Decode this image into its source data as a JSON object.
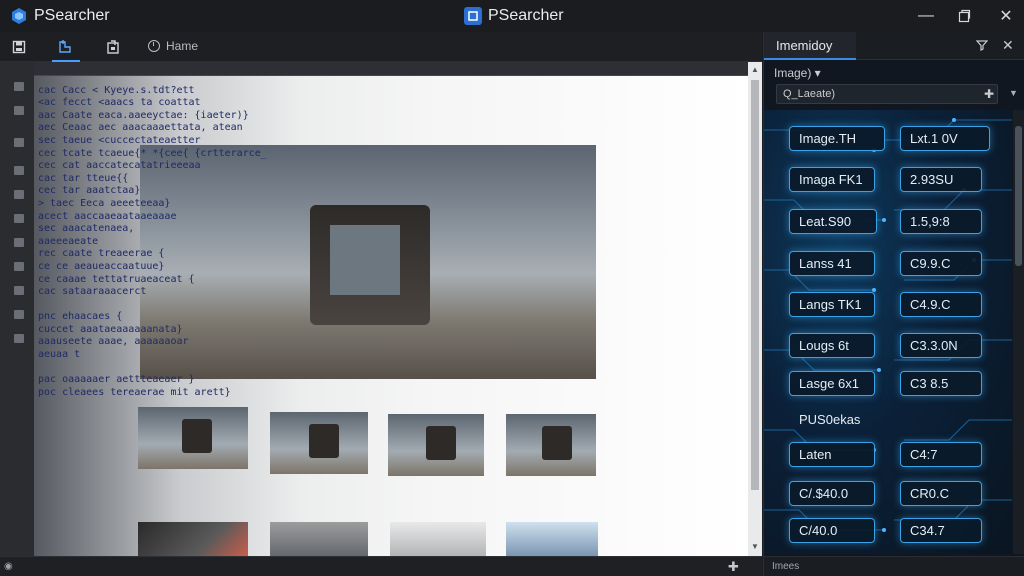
{
  "window": {
    "app_title": "PSearcher",
    "center_title": "PSearcher"
  },
  "toolbar": {
    "home_label": "Hame"
  },
  "code": {
    "lines": [
      "",
      "  cac  Cacc  <  Kyeye.s.tdt?ett",
      "  <ac  fecct  <aaacs  ta coattat",
      "   aac  Caate  eaca.aaeeyctae: {iaeter)}",
      "   aec  Ceaac  aec  aaacaaaettata, atean",
      "        sec  taeue <cuccectateaetter",
      "         cec  tcate  tcaeue{*  *{cee{  {crtterarce_",
      "          cec  cat  aaccatecatatrieeeaa",
      "           cac  tar  tteue{{",
      "            cec  tar  aaatctaa}",
      "      >  taec  Eeca  aeeeteeaa}",
      "            acect  aaccaaeaataaeaaae",
      "              sec  aaacatenaea,",
      "                     aaeeeaeate",
      "            rec  caate  treaeerae  {",
      "              ce  ce  aeaueaccaatuue}",
      "              ce  caaae  tettatruaeaceat  {",
      "                   cac  sataaraaacerct",
      "",
      "        pnc  ehaacaes  {",
      "             cuccet  aaataeaaaaaanata}",
      "              aaauseete aaae,  aaaaaaoar",
      "               aeuaa  t",
      "",
      "               pac  oaaaaaer  aettteaeaer  }",
      "               poc  cleaees  tereaerae  mit  arett}"
    ]
  },
  "panel": {
    "tab_label": "Imemidoy",
    "dropdown_label": "Image) ▾",
    "search_value": "Q_Laeate)",
    "footer_label": "Imees",
    "buttons_left": [
      "Image.TH",
      "Imaga FK1",
      "Leat.S90",
      "Lanss 41",
      "Langs TK1",
      "Lougs 6t",
      "Lasge 6x1",
      "PUS0ekas",
      "Laten",
      "C/.$40.0",
      "C/40.0"
    ],
    "buttons_right": [
      "Lxt.1 0V",
      "2.93SU",
      "1.5,9:8",
      "C9.9.C",
      "C4.9.C",
      "C3.3.0N",
      "C3 8.5",
      "",
      "C4:7",
      "CR0.C",
      "C34.7"
    ]
  },
  "colors": {
    "accent": "#3aa3e8",
    "title_bar": "#1a1c20",
    "panel_bg": "#101720"
  }
}
